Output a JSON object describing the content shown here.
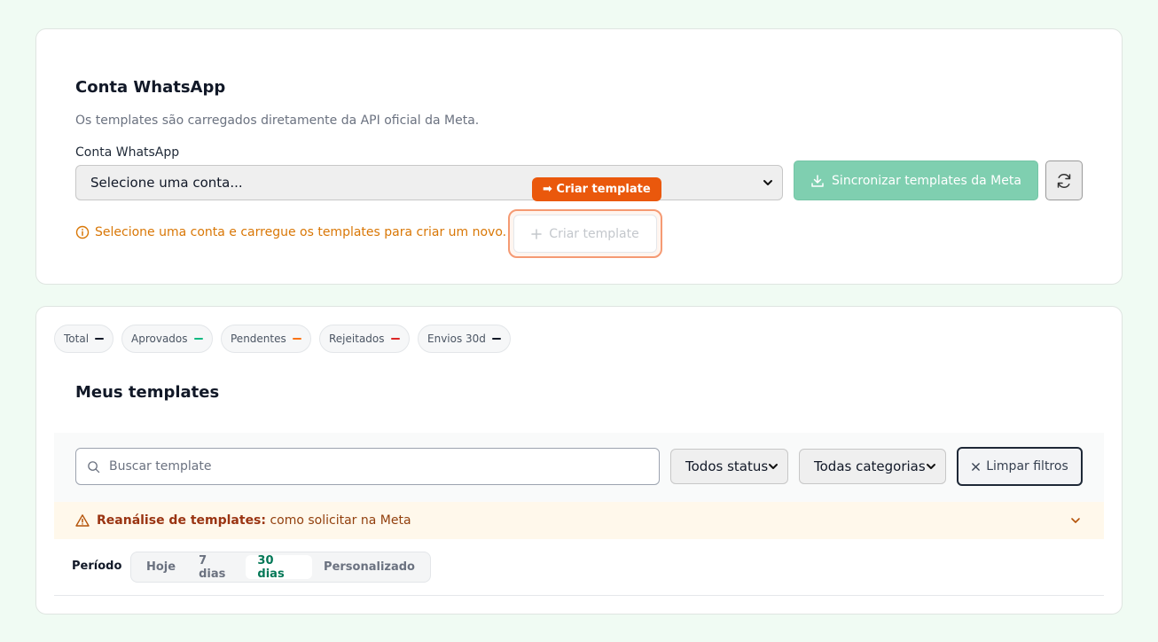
{
  "account": {
    "title": "Conta WhatsApp",
    "subtitle": "Os templates são carregados diretamente da API oficial da Meta.",
    "select_label": "Conta WhatsApp",
    "select_value": "Selecione uma conta...",
    "sync_button": "Sincronizar templates da Meta",
    "warning": "Selecione uma conta e carregue os templates para criar um novo.",
    "create_button": "Criar template",
    "tooltip": "➡ Criar template"
  },
  "stats": [
    {
      "label": "Total",
      "value": "—",
      "color": "#111827"
    },
    {
      "label": "Aprovados",
      "value": "—",
      "color": "#10b981"
    },
    {
      "label": "Pendentes",
      "value": "—",
      "color": "#f97316"
    },
    {
      "label": "Rejeitados",
      "value": "—",
      "color": "#dc2626"
    },
    {
      "label": "Envios 30d",
      "value": "—",
      "color": "#111827"
    }
  ],
  "templates": {
    "title": "Meus templates",
    "search_placeholder": "Buscar template",
    "status_filter": "Todos status",
    "category_filter": "Todas categorias",
    "clear_filters": "Limpar filtros",
    "reanalise_bold": "Reanálise de templates:",
    "reanalise_text": "como solicitar na Meta",
    "period_label": "Período",
    "periods": [
      "Hoje",
      "7 dias",
      "30 dias",
      "Personalizado"
    ],
    "active_period": "30 dias"
  }
}
